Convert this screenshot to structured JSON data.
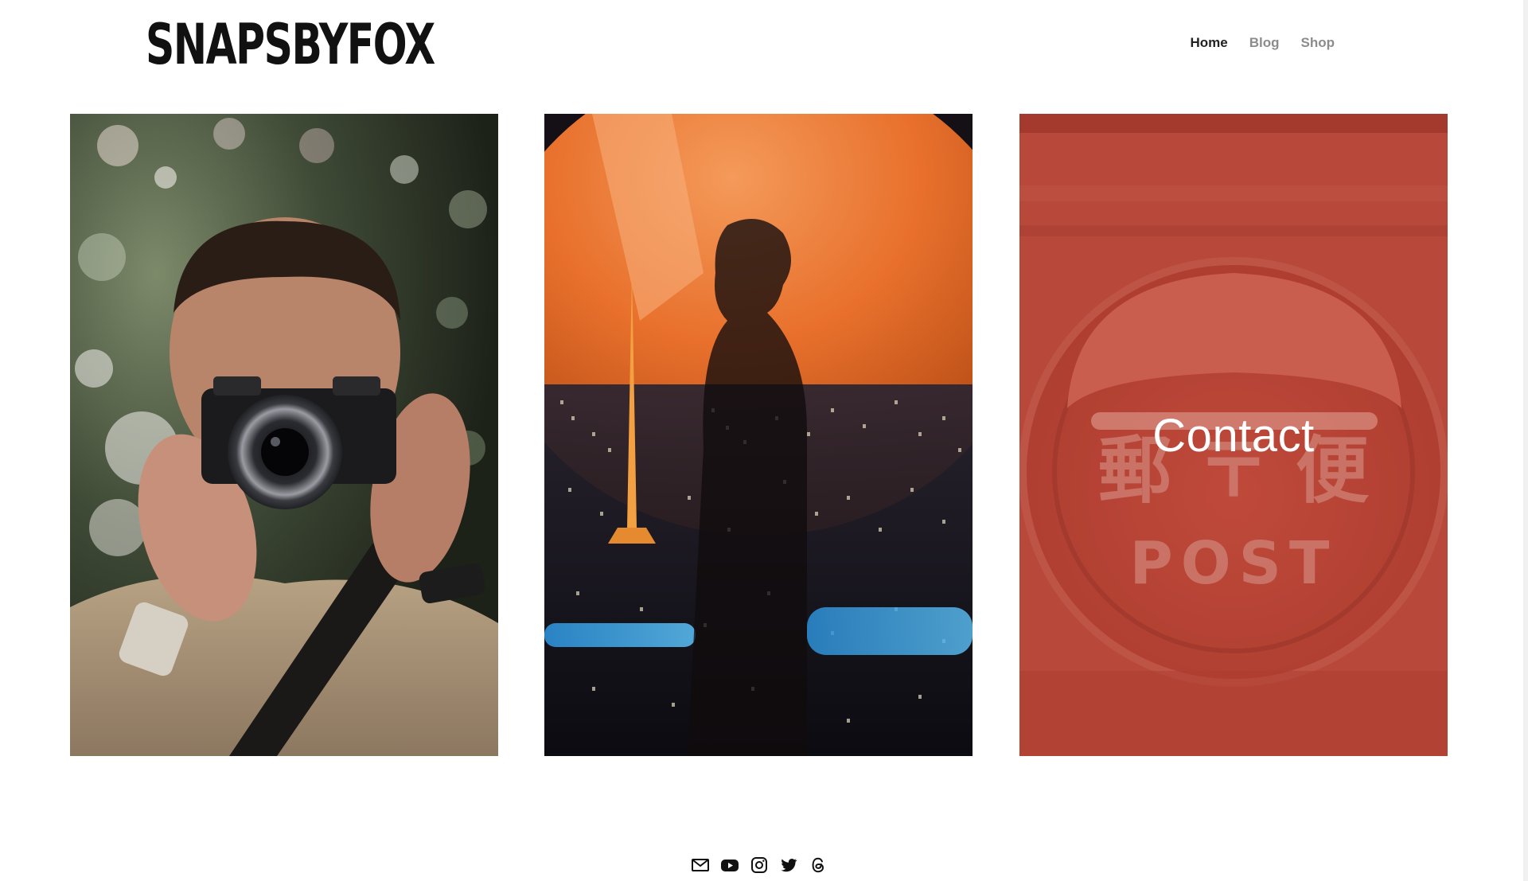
{
  "site": {
    "logo_text": "SNAPSBYFOX"
  },
  "nav": {
    "items": [
      {
        "label": "Home",
        "state": "active"
      },
      {
        "label": "Blog",
        "state": "inactive"
      },
      {
        "label": "Shop",
        "state": "inactive"
      }
    ]
  },
  "gallery": {
    "tiles": [
      {
        "subject": "photographer holding camera",
        "overlay_label": ""
      },
      {
        "subject": "silhouette over city at night",
        "overlay_label": ""
      },
      {
        "subject": "red post box",
        "overlay_label": "Contact",
        "box_text_kanji": "郵 〒 便",
        "box_text_latin": "POST"
      }
    ]
  },
  "footer": {
    "social_icons": [
      "email-icon",
      "youtube-icon",
      "instagram-icon",
      "twitter-icon",
      "threads-icon"
    ]
  },
  "colors": {
    "text_primary": "#222222",
    "text_muted": "#8c8c8c",
    "contact_overlay": "#b8483a"
  }
}
